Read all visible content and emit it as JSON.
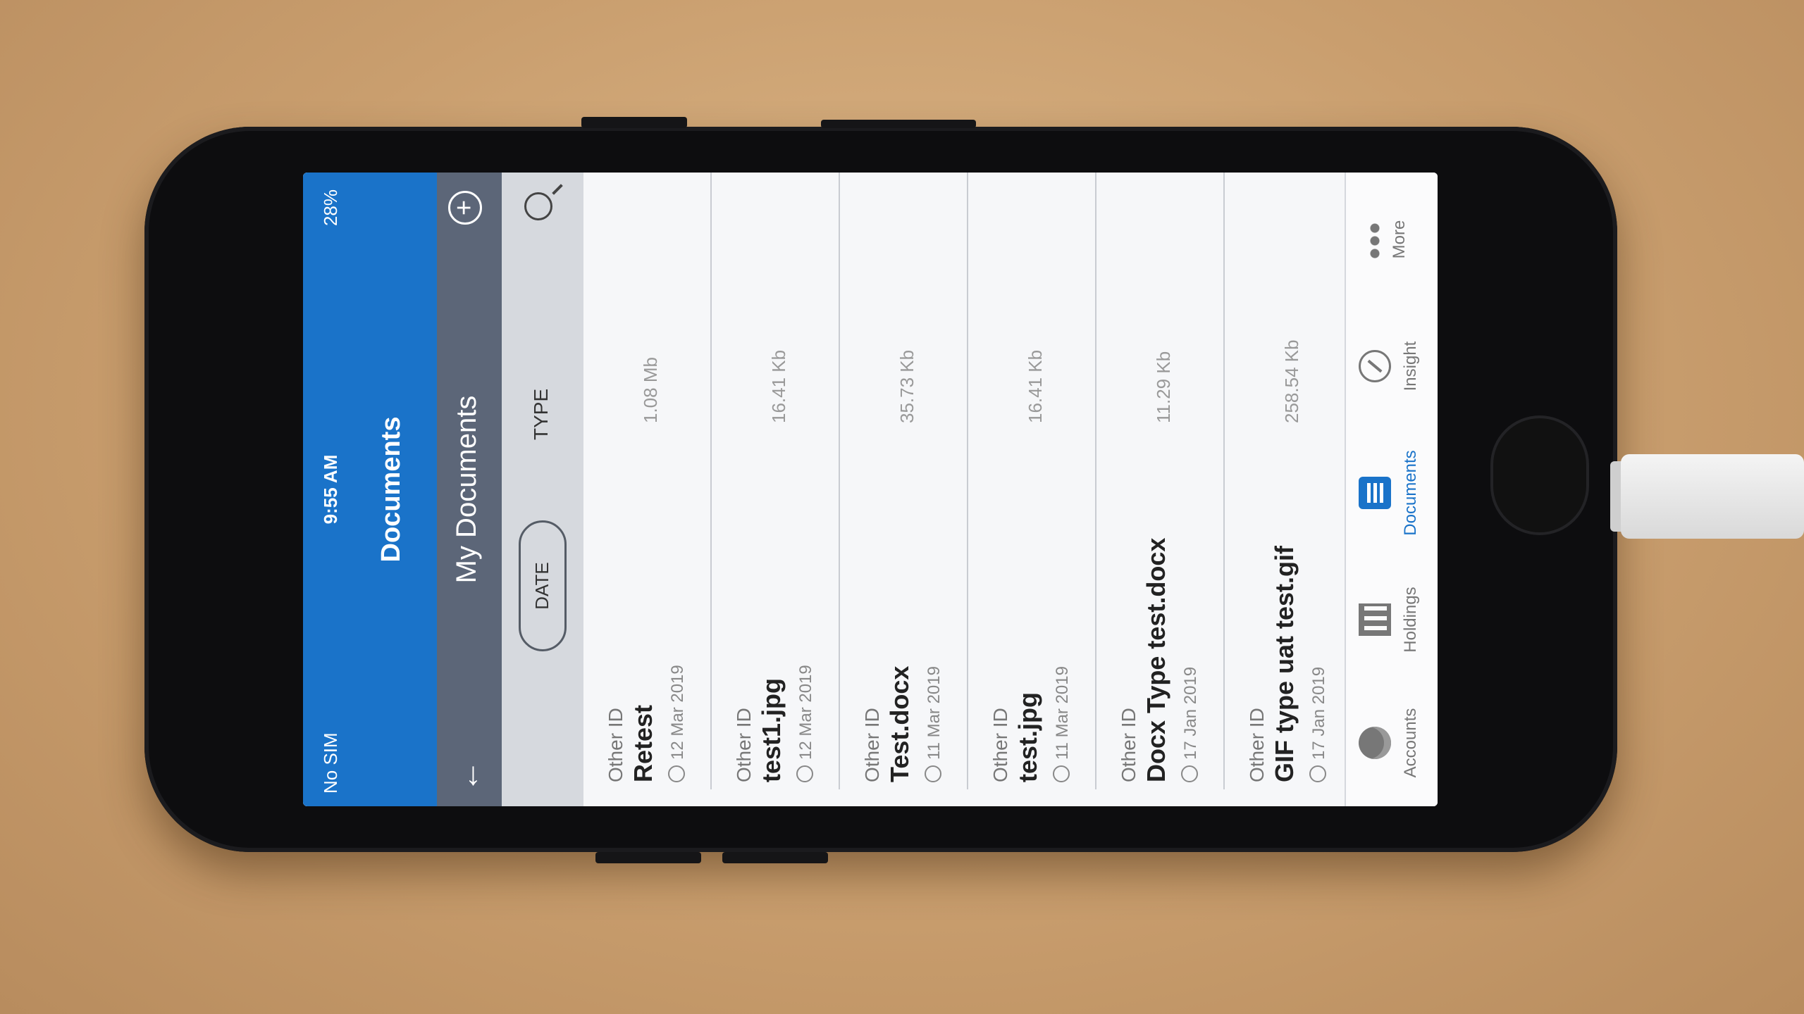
{
  "status_bar": {
    "carrier": "No SIM",
    "time": "9:55 AM",
    "battery": "28%"
  },
  "app": {
    "title": "Documents"
  },
  "header": {
    "title": "My Documents",
    "back_icon": "arrow-left-icon",
    "add_icon": "plus-circle-icon"
  },
  "filters": {
    "date_label": "DATE",
    "type_label": "TYPE",
    "search_icon": "search-icon"
  },
  "documents": [
    {
      "kind": "Other ID",
      "name": "Retest",
      "date": "12 Mar 2019",
      "size": "1.08 Mb"
    },
    {
      "kind": "Other ID",
      "name": "test1.jpg",
      "date": "12 Mar 2019",
      "size": "16.41 Kb"
    },
    {
      "kind": "Other ID",
      "name": "Test.docx",
      "date": "11 Mar 2019",
      "size": "35.73 Kb"
    },
    {
      "kind": "Other ID",
      "name": "test.jpg",
      "date": "11 Mar 2019",
      "size": "16.41 Kb"
    },
    {
      "kind": "Other ID",
      "name": "Docx Type test.docx",
      "date": "17 Jan 2019",
      "size": "11.29 Kb"
    },
    {
      "kind": "Other ID",
      "name": "GIF type uat test.gif",
      "date": "17 Jan 2019",
      "size": "258.54 Kb"
    }
  ],
  "tabs": [
    {
      "label": "Accounts",
      "icon": "accounts-icon"
    },
    {
      "label": "Holdings",
      "icon": "holdings-icon"
    },
    {
      "label": "Documents",
      "icon": "documents-icon",
      "active": true
    },
    {
      "label": "Insight",
      "icon": "compass-icon"
    },
    {
      "label": "More",
      "icon": "more-icon"
    }
  ],
  "colors": {
    "primary": "#1a73c9",
    "subheader": "#5c6678",
    "filterbar": "#d6d9de"
  }
}
